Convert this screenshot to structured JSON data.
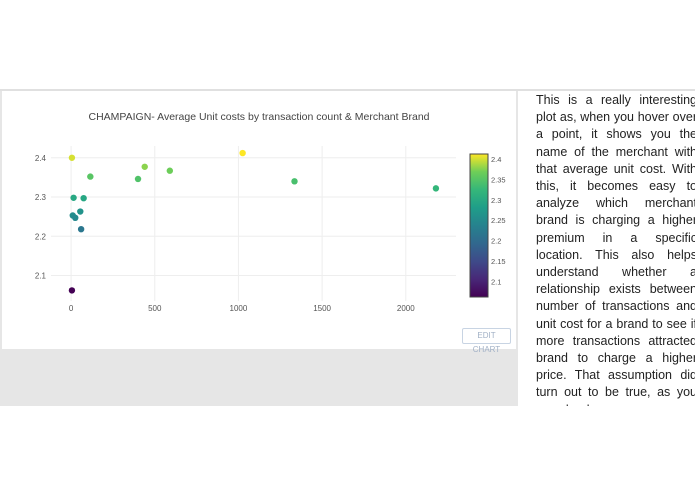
{
  "chart_data": {
    "type": "scatter",
    "title": "CHAMPAIGN- Average Unit costs by transaction count & Merchant Brand",
    "xlabel": "",
    "ylabel": "",
    "xlim": [
      -120,
      2300
    ],
    "ylim": [
      2.035,
      2.43
    ],
    "x_ticks": [
      0,
      500,
      1000,
      1500,
      2000
    ],
    "y_ticks": [
      2.1,
      2.2,
      2.3,
      2.4
    ],
    "grid": true,
    "points": [
      {
        "x": 5,
        "y": 2.4
      },
      {
        "x": 115,
        "y": 2.352
      },
      {
        "x": 15,
        "y": 2.298
      },
      {
        "x": 75,
        "y": 2.297
      },
      {
        "x": 55,
        "y": 2.263
      },
      {
        "x": 10,
        "y": 2.253
      },
      {
        "x": 25,
        "y": 2.247
      },
      {
        "x": 60,
        "y": 2.218
      },
      {
        "x": 5,
        "y": 2.062
      },
      {
        "x": 400,
        "y": 2.346
      },
      {
        "x": 440,
        "y": 2.377
      },
      {
        "x": 590,
        "y": 2.367
      },
      {
        "x": 1025,
        "y": 2.412
      },
      {
        "x": 1335,
        "y": 2.34
      },
      {
        "x": 2180,
        "y": 2.322
      }
    ],
    "colorbar": {
      "min": 2.062,
      "max": 2.412,
      "ticks": [
        "2.4",
        "2.35",
        "2.3",
        "2.25",
        "2.2",
        "2.15",
        "2.1"
      ],
      "colorscale": "viridis"
    }
  },
  "edit_chart_label": "EDIT CHART",
  "description": "This is a really interesting plot as, when you hover over a point, it shows you the name of the merchant with that average unit cost. With this, it becomes easy to analyze which merchant brand is charging a higher premium in a specific location. This also helps understand whether a relationship exists between number of transactions and unit cost for a brand to see if more transactions attracted brand to charge a higher price. That assumption did turn out to be true, as you can clearly see."
}
